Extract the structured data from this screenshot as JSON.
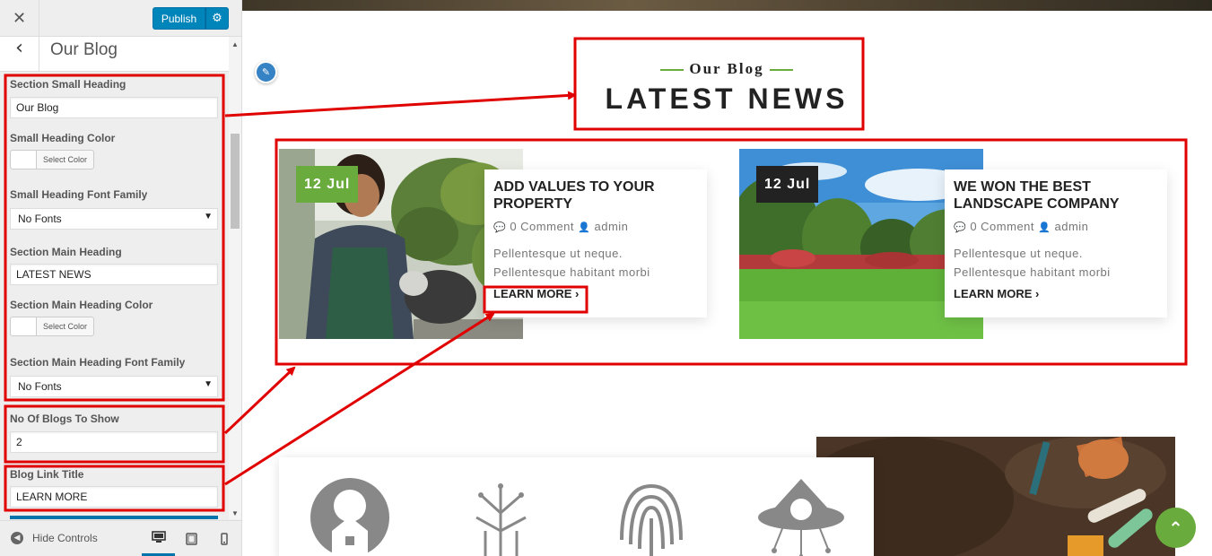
{
  "customizer": {
    "close_icon": "close-icon",
    "publish_label": "Publish",
    "settings_icon": "gear-icon",
    "back_icon": "chevron-left-icon",
    "section_title": "Our Blog",
    "fields": {
      "small_heading_label": "Section Small Heading",
      "small_heading_value": "Our Blog",
      "small_heading_color_label": "Small Heading Color",
      "select_color_label": "Select Color",
      "small_heading_font_label": "Small Heading Font Family",
      "small_heading_font_value": "No Fonts",
      "main_heading_label": "Section Main Heading",
      "main_heading_value": "LATEST NEWS",
      "main_heading_color_label": "Section Main Heading Color",
      "main_heading_font_label": "Section Main Heading Font Family",
      "main_heading_font_value": "No Fonts",
      "blogs_count_label": "No Of Blogs To Show",
      "blogs_count_value": "2",
      "link_title_label": "Blog Link Title",
      "link_title_value": "LEARN MORE"
    },
    "footer": {
      "hide_controls_label": "Hide Controls",
      "devices": [
        "desktop",
        "tablet",
        "mobile"
      ]
    }
  },
  "preview": {
    "small_heading": "Our Blog",
    "main_heading": "LATEST NEWS",
    "posts": [
      {
        "date": "12 Jul",
        "title": "ADD VALUES TO YOUR PROPERTY",
        "comments": "0 Comment",
        "author": "admin",
        "excerpt_line1": "Pellentesque ut neque.",
        "excerpt_line2": "Pellentesque habitant morbi",
        "link": "LEARN MORE"
      },
      {
        "date": "12 Jul",
        "title": "WE WON THE BEST LANDSCAPE COMPANY",
        "comments": "0 Comment",
        "author": "admin",
        "excerpt_line1": "Pellentesque ut neque.",
        "excerpt_line2": "Pellentesque habitant morbi",
        "link": "LEARN MORE"
      }
    ],
    "feature_icons": [
      "tree-house-icon",
      "circuit-tree-icon",
      "fingerprint-icon",
      "ufo-icon"
    ]
  },
  "colors": {
    "accent_green": "#6aab3d",
    "dark_badge": "#222222",
    "wp_blue": "#0085ba",
    "annotation_red": "#e00000"
  }
}
